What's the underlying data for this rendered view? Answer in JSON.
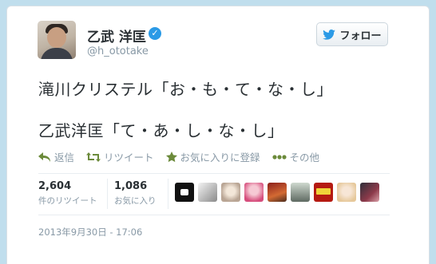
{
  "user": {
    "name": "乙武 洋匡",
    "handle": "@h_ototake",
    "verified_icon": "verified-badge-icon"
  },
  "follow_button": {
    "label": "フォロー",
    "icon": "twitter-bird-icon"
  },
  "tweet": {
    "line1": "滝川クリステル「お・も・て・な・し」",
    "line2": "乙武洋匡「て・あ・し・な・し」"
  },
  "actions": [
    {
      "label": "返信",
      "icon": "reply-icon"
    },
    {
      "label": "リツイート",
      "icon": "retweet-icon"
    },
    {
      "label": "お気に入りに登録",
      "icon": "star-icon"
    },
    {
      "label": "その他",
      "icon": "more-dots-icon"
    }
  ],
  "stats": {
    "retweets": {
      "count": "2,604",
      "label": "件のリツイート"
    },
    "favorites": {
      "count": "1,086",
      "label": "お気に入り"
    }
  },
  "timestamp": "2013年9月30日 - 17:06",
  "colors": {
    "accent": "#2b9ae6",
    "background": "#c0deed",
    "muted": "#8899a6"
  }
}
